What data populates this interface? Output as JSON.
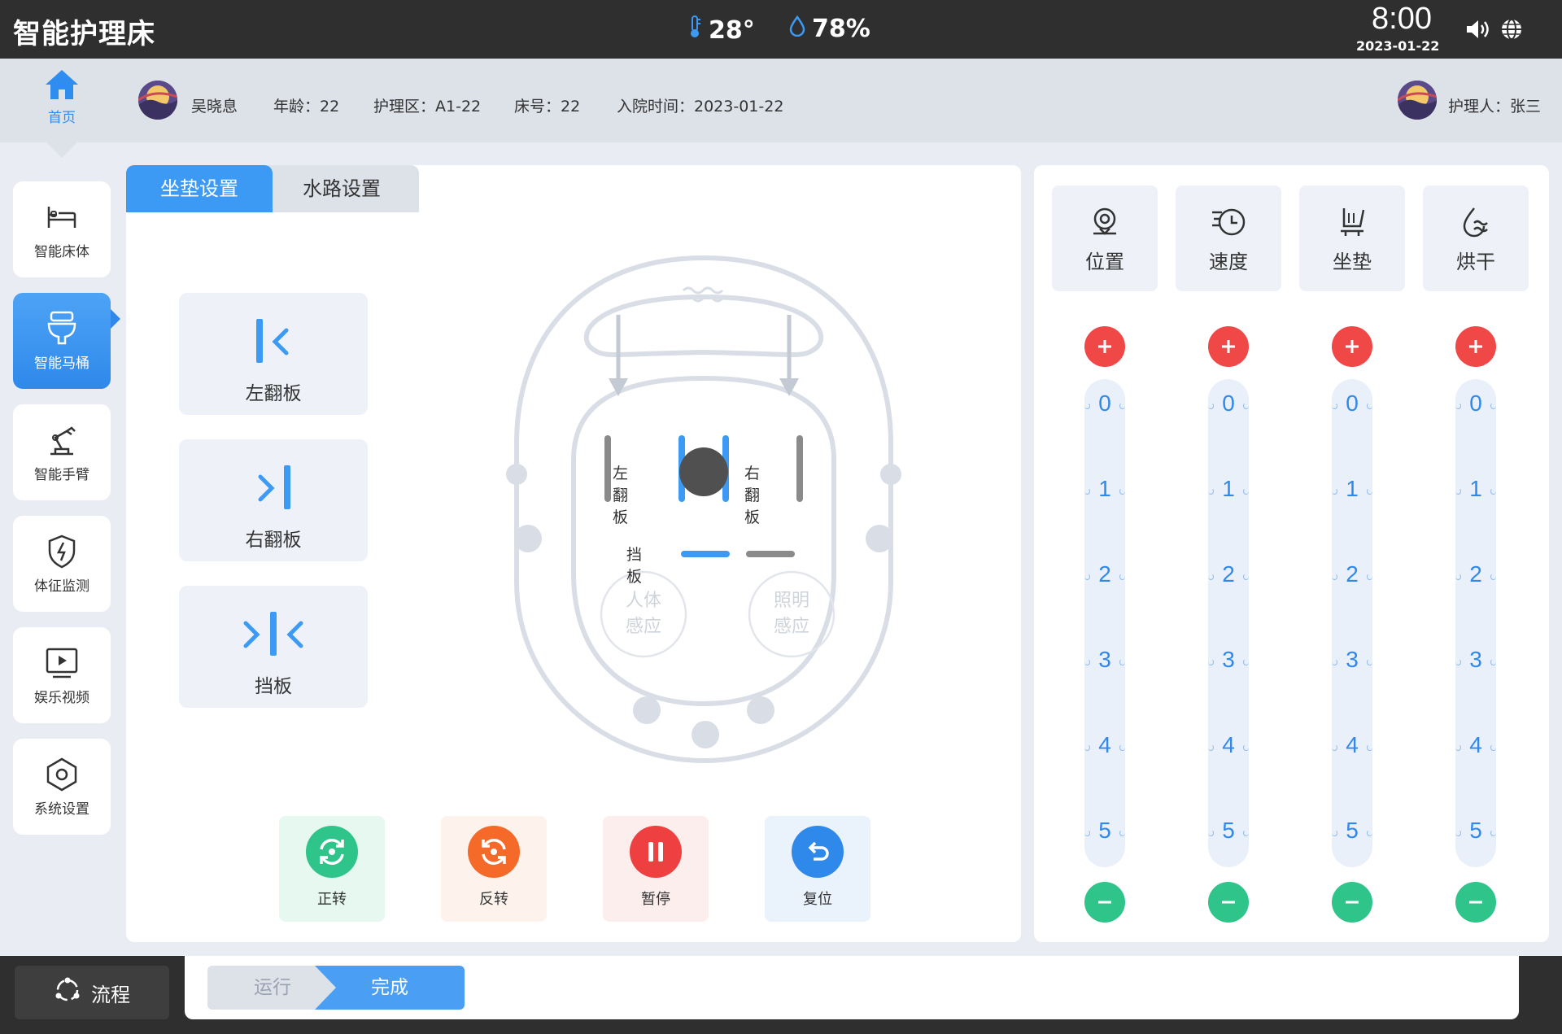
{
  "app": {
    "title": "智能护理床"
  },
  "env": {
    "temperature": "28°",
    "humidity": "78%"
  },
  "clock": {
    "time": "8:00",
    "date": "2023-01-22"
  },
  "home": {
    "label": "首页"
  },
  "patient": {
    "name": "吴晓息",
    "age": "年龄：22",
    "zone": "护理区：A1-22",
    "bed": "床号：22",
    "admission": "入院时间：2023-01-22"
  },
  "caregiver": {
    "label": "护理人：张三"
  },
  "sidebar": {
    "items": [
      {
        "label": "智能床体",
        "icon": "bed-icon"
      },
      {
        "label": "智能马桶",
        "icon": "toilet-icon",
        "active": true
      },
      {
        "label": "智能手臂",
        "icon": "robot-arm-icon"
      },
      {
        "label": "体征监测",
        "icon": "shield-pulse-icon"
      },
      {
        "label": "娱乐视频",
        "icon": "video-icon"
      },
      {
        "label": "系统设置",
        "icon": "settings-hex-icon"
      }
    ]
  },
  "tabs": {
    "cushion": "坐垫设置",
    "water": "水路设置"
  },
  "flip_buttons": {
    "left": "左翻板",
    "right": "右翻板",
    "baffle": "挡板"
  },
  "diagram": {
    "left_flap": "左翻板",
    "right_flap": "右翻板",
    "baffle": "挡板",
    "body_sense_1": "人体",
    "body_sense_2": "感应",
    "light_sense_1": "照明",
    "light_sense_2": "感应"
  },
  "controls": {
    "forward": "正转",
    "reverse": "反转",
    "pause": "暂停",
    "reset": "复位"
  },
  "right_panel": {
    "cards": [
      {
        "label": "位置",
        "icon": "position-icon"
      },
      {
        "label": "速度",
        "icon": "speed-icon"
      },
      {
        "label": "坐垫",
        "icon": "seat-icon"
      },
      {
        "label": "烘干",
        "icon": "dry-icon"
      }
    ],
    "levels": [
      "0",
      "1",
      "2",
      "3",
      "4",
      "5"
    ]
  },
  "bottom": {
    "flow": "流程",
    "step_run": "运行",
    "step_done": "完成"
  },
  "colors": {
    "accent": "#2f89ea",
    "plus": "#f04747",
    "minus": "#2fc48a",
    "dark": "#2f2f2f"
  }
}
